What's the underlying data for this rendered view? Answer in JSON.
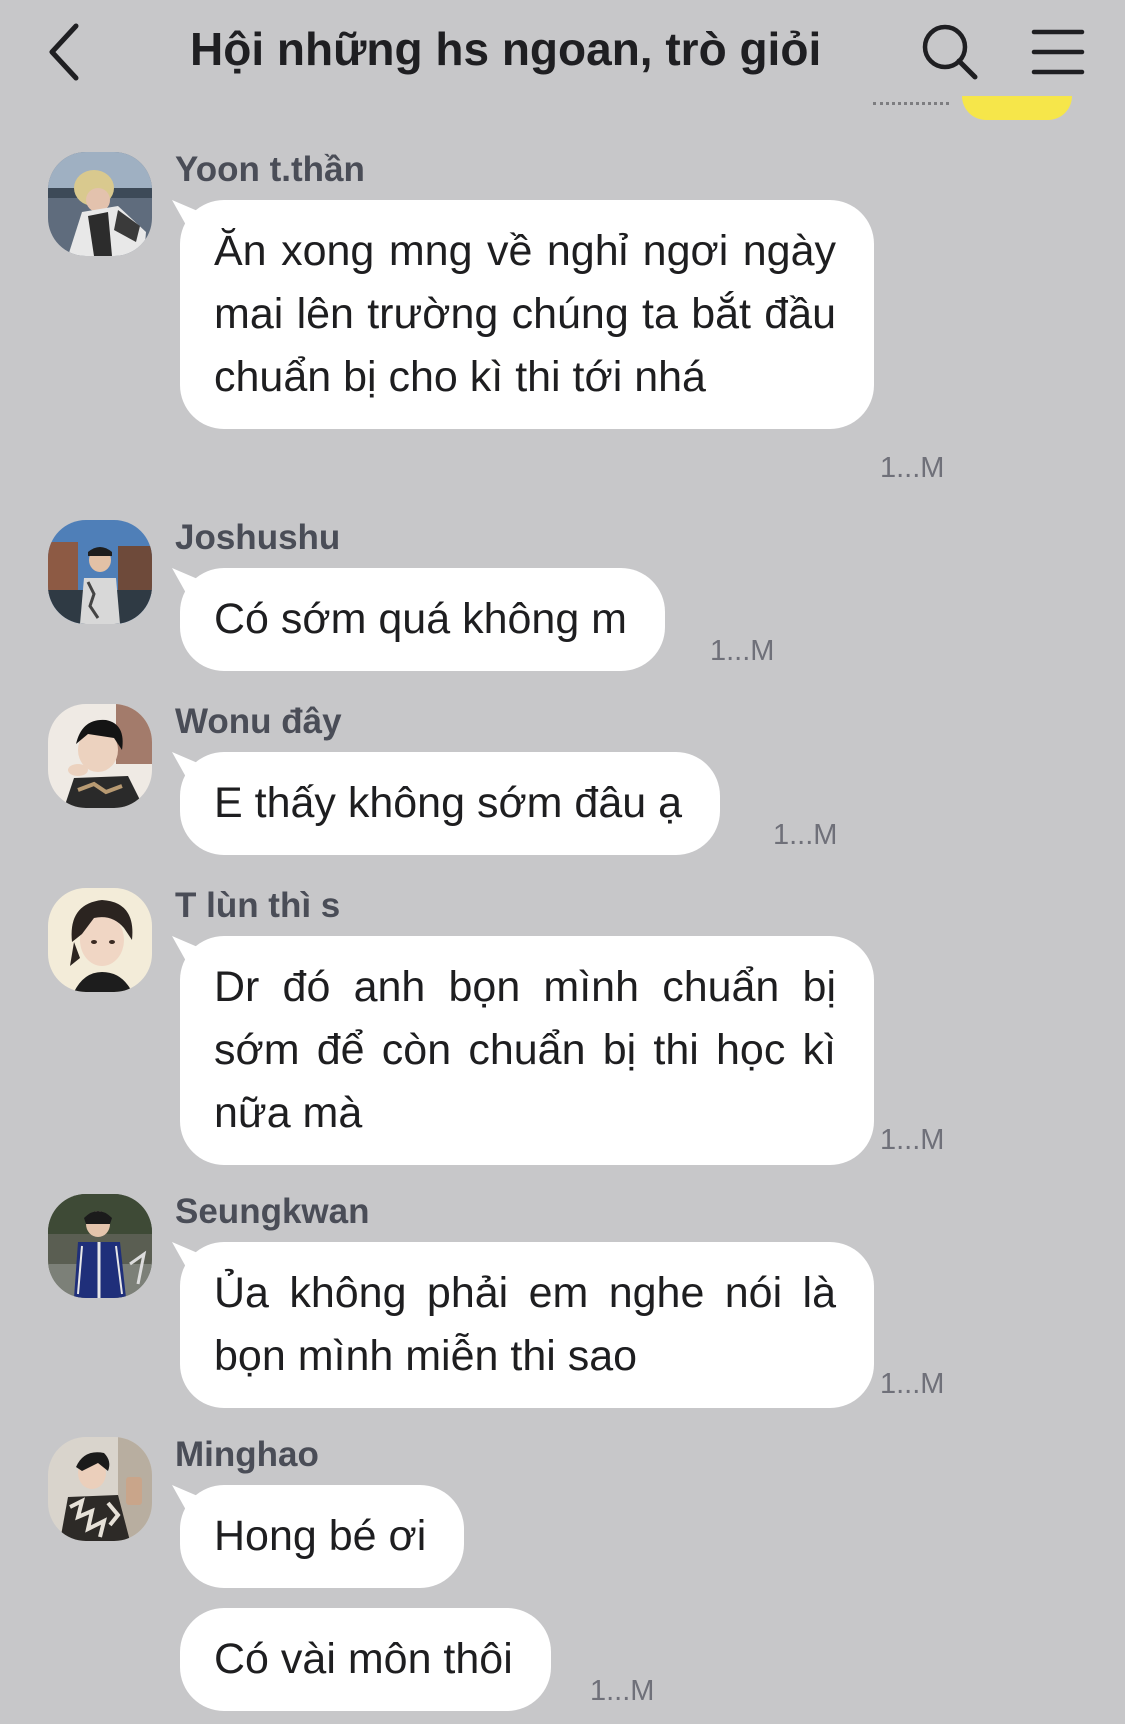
{
  "header": {
    "title": "Hội những hs ngoan, trò giỏi"
  },
  "icons": {
    "back": "chevron-left-icon",
    "search": "search-icon",
    "menu": "hamburger-menu-icon"
  },
  "colors": {
    "background": "#c7c7c9",
    "bubble": "#ffffff",
    "sender": "#4a4d57",
    "timestamp": "#6f7079",
    "accent": "#f6e64a"
  },
  "messages": [
    {
      "sender": "Yoon t.thần",
      "bubbles": [
        {
          "text": "Ăn xong mng về nghỉ ngơi ngày mai lên trường chúng ta bắt đầu chuẩn bị cho kì thi tới nhá",
          "time": "1...M"
        }
      ]
    },
    {
      "sender": "Joshushu",
      "bubbles": [
        {
          "text": "Có sớm quá không m",
          "time": "1...M"
        }
      ]
    },
    {
      "sender": "Wonu đây",
      "bubbles": [
        {
          "text": "E thấy không sớm đâu ạ",
          "time": "1...M"
        }
      ]
    },
    {
      "sender": "T lùn thì s",
      "bubbles": [
        {
          "text": "Dr đó anh bọn mình chuẩn bị sớm để còn chuẩn bị thi học kì nữa mà",
          "time": "1...M"
        }
      ]
    },
    {
      "sender": "Seungkwan",
      "bubbles": [
        {
          "text": "Ủa không phải em nghe nói là bọn mình miễn thi sao",
          "time": "1...M"
        }
      ]
    },
    {
      "sender": "Minghao",
      "bubbles": [
        {
          "text": "Hong bé ơi",
          "time": ""
        },
        {
          "text": "Có vài môn thôi",
          "time": "1...M"
        }
      ]
    }
  ]
}
